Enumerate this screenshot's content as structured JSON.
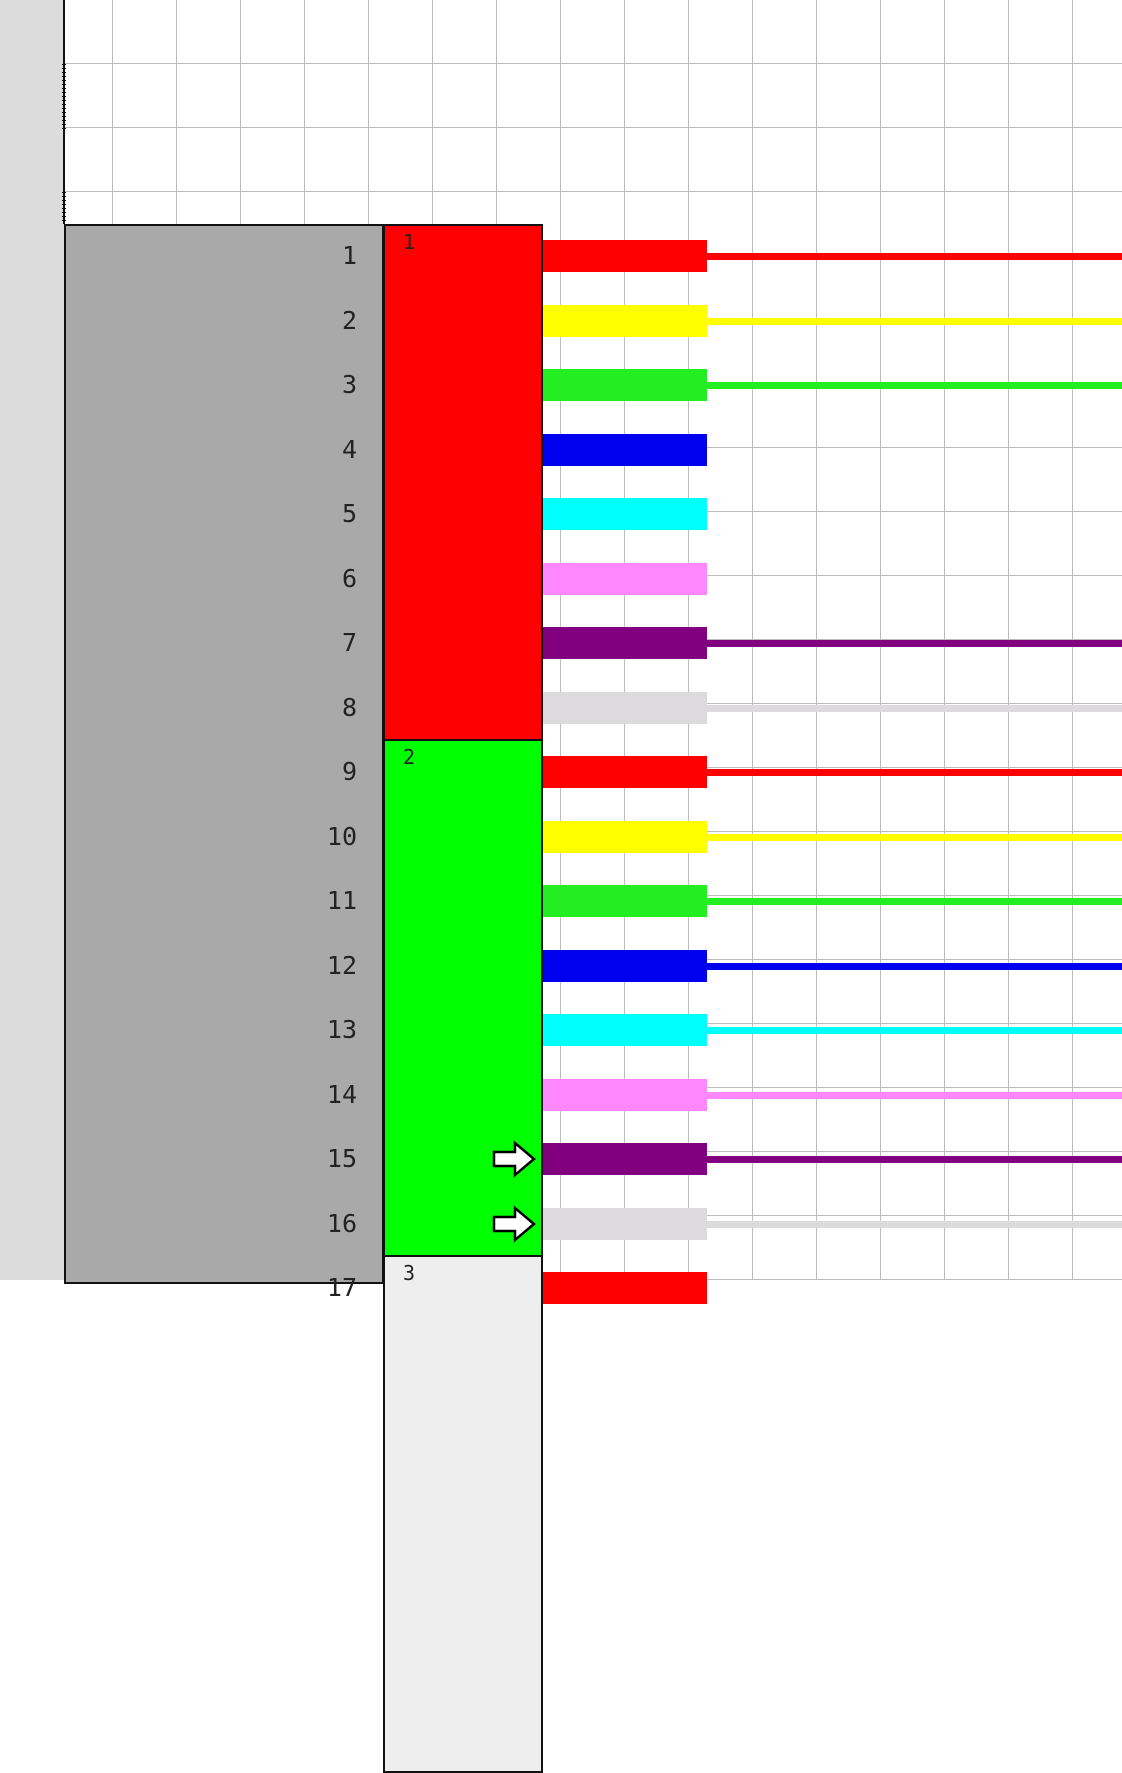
{
  "panel": {
    "port_labels": [
      "1",
      "2",
      "3",
      "4",
      "5",
      "6",
      "7",
      "8",
      "9",
      "10",
      "11",
      "12",
      "13",
      "14",
      "15",
      "16",
      "17"
    ]
  },
  "groups": [
    {
      "label": "1",
      "color": "#ff0000"
    },
    {
      "label": "2",
      "color": "#00ff00"
    },
    {
      "label": "3",
      "color": "#eeeeee"
    }
  ],
  "ports": [
    {
      "number": "1",
      "color": "#ff0000",
      "line": true,
      "arrow": false
    },
    {
      "number": "2",
      "color": "#ffff00",
      "line": true,
      "arrow": false
    },
    {
      "number": "3",
      "color": "#22ee22",
      "line": true,
      "arrow": false
    },
    {
      "number": "4",
      "color": "#0000ee",
      "line": false,
      "arrow": false
    },
    {
      "number": "5",
      "color": "#00ffff",
      "line": false,
      "arrow": false
    },
    {
      "number": "6",
      "color": "#ff88ff",
      "line": false,
      "arrow": false
    },
    {
      "number": "7",
      "color": "#800080",
      "line": true,
      "arrow": false
    },
    {
      "number": "8",
      "color": "#dddadd",
      "line": true,
      "arrow": false
    },
    {
      "number": "9",
      "color": "#ff0000",
      "line": true,
      "arrow": false
    },
    {
      "number": "10",
      "color": "#ffff00",
      "line": true,
      "arrow": false
    },
    {
      "number": "11",
      "color": "#22ee22",
      "line": true,
      "arrow": false
    },
    {
      "number": "12",
      "color": "#0000ee",
      "line": true,
      "arrow": false
    },
    {
      "number": "13",
      "color": "#00ffff",
      "line": true,
      "arrow": false
    },
    {
      "number": "14",
      "color": "#ff88ff",
      "line": true,
      "arrow": false
    },
    {
      "number": "15",
      "color": "#800080",
      "line": true,
      "arrow": true
    },
    {
      "number": "16",
      "color": "#dddadd",
      "line": true,
      "arrow": true
    },
    {
      "number": "17",
      "color": "#ff0000",
      "line": false,
      "arrow": false
    }
  ],
  "icons": {
    "arrow": "arrow-right-icon"
  }
}
